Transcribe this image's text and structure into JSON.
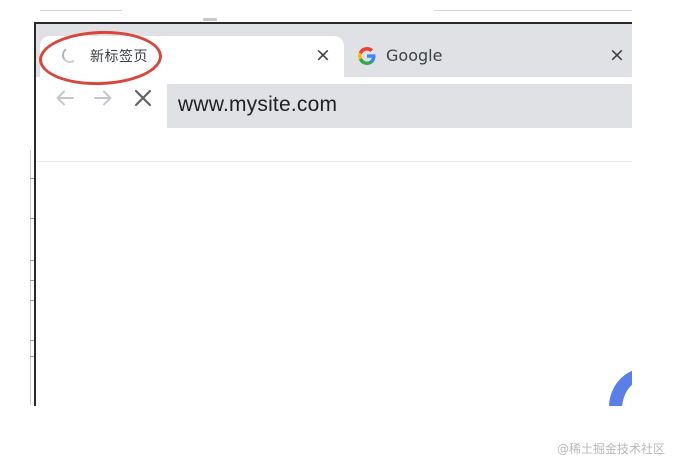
{
  "browser": {
    "tabs": [
      {
        "title": "新标签页",
        "state": "loading",
        "active": true,
        "close_label": "×"
      },
      {
        "title": "Google",
        "icon": "google-g-icon",
        "active": false,
        "close_label": "×"
      }
    ],
    "toolbar": {
      "back_icon": "arrow-left-icon",
      "forward_icon": "arrow-right-icon",
      "stop_icon": "close-icon"
    },
    "omnibox": {
      "url": "www.mysite.com"
    }
  },
  "colors": {
    "annotation_ring": "#d9463b",
    "tab_strip": "#dfe1e5",
    "omnibox": "#dfe1e5",
    "arc_accent": "#5b7fe8"
  },
  "watermark": {
    "text": "@稀土掘金技术社区"
  }
}
